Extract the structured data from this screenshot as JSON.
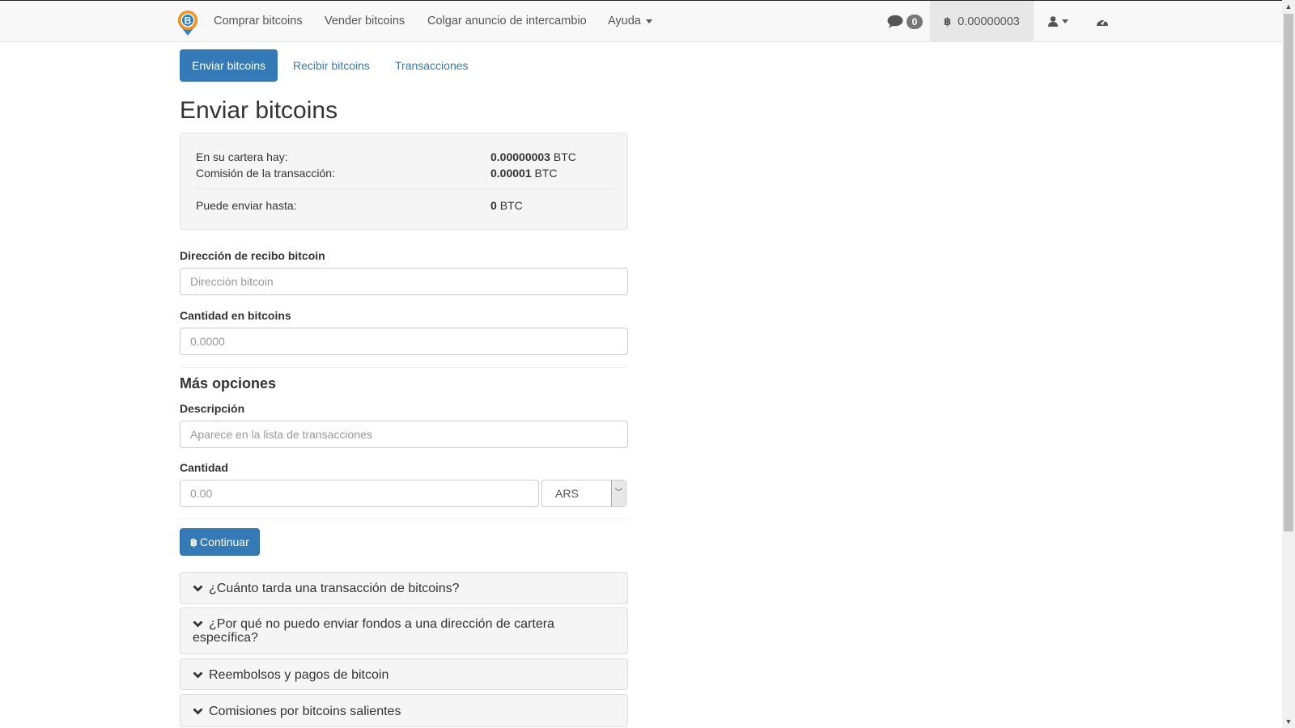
{
  "navbar": {
    "links": [
      "Comprar bitcoins",
      "Vender bitcoins",
      "Colgar anuncio de intercambio",
      "Ayuda"
    ],
    "messages_count": "0",
    "wallet_balance": "0.00000003",
    "btc_symbol": "฿"
  },
  "tabs": [
    "Enviar bitcoins",
    "Recibir bitcoins",
    "Transacciones"
  ],
  "page_title": "Enviar bitcoins",
  "wallet_summary": {
    "balance_label": "En su cartera hay:",
    "balance_value": "0.00000003",
    "fee_label": "Comisión de la transacción:",
    "fee_value": "0.00001",
    "max_label": "Puede enviar hasta:",
    "max_value": "0",
    "unit": "BTC"
  },
  "form": {
    "address_label": "Dirección de recibo bitcoin",
    "address_placeholder": "Dirección bitcoin",
    "amount_label": "Cantidad en bitcoins",
    "amount_placeholder": "0.0000",
    "more_options": "Más opciones",
    "description_label": "Descripción",
    "description_placeholder": "Aparece en la lista de transacciones",
    "fiat_label": "Cantidad",
    "fiat_placeholder": "0.00",
    "currency": "ARS",
    "continue_button": "Continuar"
  },
  "faq": [
    "¿Cuánto tarda una transacción de bitcoins?",
    "¿Por qué no puedo enviar fondos a una dirección de cartera específica?",
    "Reembolsos y pagos de bitcoin",
    "Comisiones por bitcoins salientes"
  ],
  "colors": {
    "primary": "#337ab7",
    "navbar_bg": "#f8f8f8",
    "logo_orange": "#f7931a",
    "logo_blue": "#2b83c6"
  }
}
